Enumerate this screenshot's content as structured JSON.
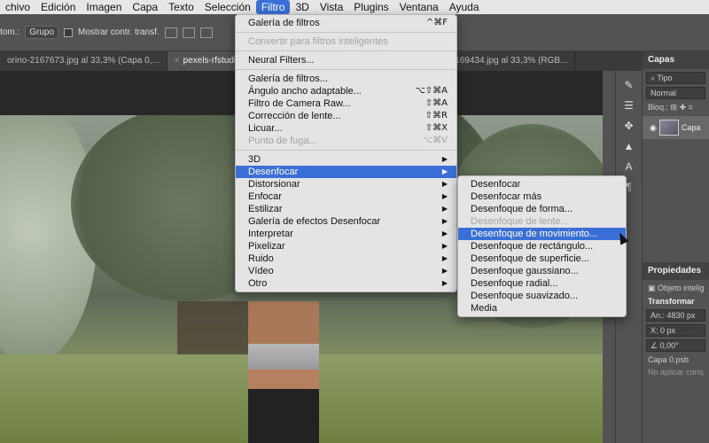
{
  "menubar": {
    "items": [
      "chivo",
      "Edición",
      "Imagen",
      "Capa",
      "Texto",
      "Selección",
      "Filtro",
      "3D",
      "Vista",
      "Plugins",
      "Ventana",
      "Ayuda"
    ],
    "active_index": 6
  },
  "options_bar": {
    "label_auto": "tom.:",
    "group_select": "Grupo",
    "show_controls": "Mostrar contr. transf."
  },
  "tabs": [
    {
      "label": "orino-2167673.jpg al 33,3% (Capa 0,..."
    },
    {
      "label": "pexels-rfstudio-30"
    },
    {
      "label": "rdi-2169434.jpg al 33,3% (RGB..."
    }
  ],
  "filter_menu": {
    "items": [
      {
        "label": "Galería de filtros",
        "shortcut": "^⌘F",
        "disabled": false
      },
      {
        "sep": true
      },
      {
        "label": "Convertir para filtros inteligentes",
        "disabled": true
      },
      {
        "sep": true
      },
      {
        "label": "Neural Filters...",
        "disabled": false
      },
      {
        "sep": true
      },
      {
        "label": "Galería de filtros...",
        "disabled": false
      },
      {
        "label": "Ángulo ancho adaptable...",
        "shortcut": "⌥⇧⌘A",
        "disabled": false
      },
      {
        "label": "Filtro de Camera Raw...",
        "shortcut": "⇧⌘A",
        "disabled": false
      },
      {
        "label": "Corrección de lente...",
        "shortcut": "⇧⌘R",
        "disabled": false
      },
      {
        "label": "Licuar...",
        "shortcut": "⇧⌘X",
        "disabled": false
      },
      {
        "label": "Punto de fuga...",
        "shortcut": "⌥⌘V",
        "disabled": true
      },
      {
        "sep": true
      },
      {
        "label": "3D",
        "submenu": true
      },
      {
        "label": "Desenfocar",
        "submenu": true,
        "highlight": true
      },
      {
        "label": "Distorsionar",
        "submenu": true
      },
      {
        "label": "Enfocar",
        "submenu": true
      },
      {
        "label": "Estilizar",
        "submenu": true
      },
      {
        "label": "Galería de efectos Desenfocar",
        "submenu": true
      },
      {
        "label": "Interpretar",
        "submenu": true
      },
      {
        "label": "Pixelizar",
        "submenu": true
      },
      {
        "label": "Ruido",
        "submenu": true
      },
      {
        "label": "Vídeo",
        "submenu": true
      },
      {
        "label": "Otro",
        "submenu": true
      }
    ]
  },
  "blur_submenu": {
    "items": [
      {
        "label": "Desenfocar"
      },
      {
        "label": "Desenfocar más"
      },
      {
        "label": "Desenfoque de forma..."
      },
      {
        "label": "Desenfoque de lente...",
        "disabled": true
      },
      {
        "label": "Desenfoque de movimiento...",
        "highlight": true
      },
      {
        "label": "Desenfoque de rectángulo..."
      },
      {
        "label": "Desenfoque de superficie..."
      },
      {
        "label": "Desenfoque gaussiano..."
      },
      {
        "label": "Desenfoque radial..."
      },
      {
        "label": "Desenfoque suavizado..."
      },
      {
        "label": "Media"
      }
    ]
  },
  "layers_panel": {
    "title": "Capas",
    "search": "Tipo",
    "blend_mode": "Normal",
    "lock_label": "Bloq.:",
    "layer_name": "Capa"
  },
  "properties_panel": {
    "title": "Propiedades",
    "object_type": "Objeto intelig",
    "transform_label": "Transformar",
    "width": "An.: 4830 px",
    "x": "X:  0 px",
    "angle": "0,00°",
    "file": "Capa 0.psb",
    "note": "No aplicar compo"
  },
  "colors": {
    "menu_highlight": "#3a6fd8",
    "menu_bg": "#e4e4e4",
    "app_bg": "#535353"
  }
}
